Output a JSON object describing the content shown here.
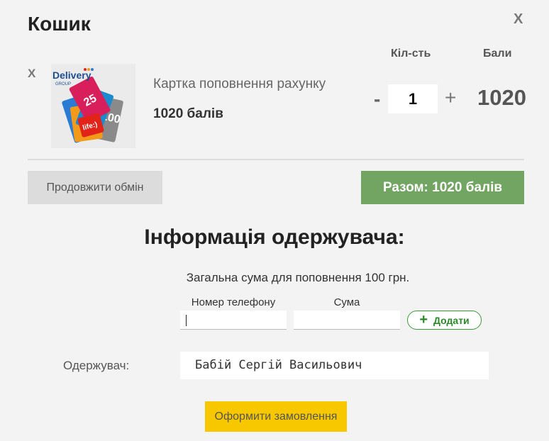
{
  "cart": {
    "title": "Кошик",
    "close_label": "X",
    "col_qty": "Кіл-сть",
    "col_points": "Бали"
  },
  "item": {
    "remove_label": "X",
    "name": "Картка поповнення рахунку",
    "price": "1020 балів",
    "qty_minus": "-",
    "qty": "1",
    "qty_plus": "+",
    "points": "1020",
    "image_brand": "Delivery",
    "image_brand_sub": "GROUP"
  },
  "actions": {
    "continue_label": "Продовжити обмін",
    "total_label": "Разом: 1020 балів"
  },
  "recipient_info": {
    "title": "Інформація одержувача:",
    "total_sum": "Загальна сума для поповнення 100 грн.",
    "phone_label": "Номер телефону",
    "sum_label": "Сума",
    "phone_value": "",
    "sum_value": "",
    "add_label": "Додати",
    "recipient_label": "Одержувач:",
    "recipient_value": "Бабій Сергій Васильович"
  },
  "order": {
    "submit_label": "Оформити замовлення"
  },
  "colors": {
    "background": "#f3f3f3",
    "total_button": "#72a562",
    "order_button": "#f7c800",
    "add_button": "#3a9a3a"
  }
}
